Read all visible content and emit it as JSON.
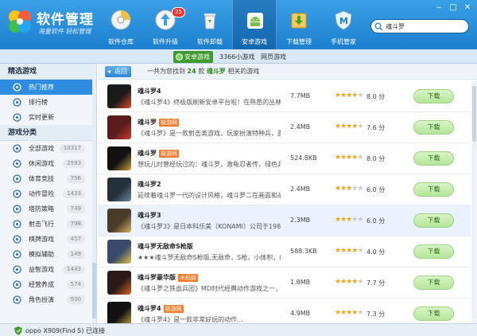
{
  "app": {
    "title": "软件管理",
    "subtitle": "海量软件 轻松管理",
    "window_controls": [
      "‒",
      "□",
      "✕"
    ]
  },
  "nav": [
    {
      "label": "软件仓库",
      "icon": "disc-icon"
    },
    {
      "label": "软件升级",
      "icon": "upgrade-icon",
      "badge": "25"
    },
    {
      "label": "软件卸载",
      "icon": "recycle-bin-icon"
    },
    {
      "label": "安卓游戏",
      "icon": "android-game-icon",
      "active": true
    },
    {
      "label": "下载管理",
      "icon": "download-icon"
    },
    {
      "label": "手机管家",
      "icon": "shield-icon"
    }
  ],
  "search": {
    "value": "魂斗罗"
  },
  "subtabs": [
    {
      "label": "安卓游戏",
      "active": true
    },
    {
      "label": "3366小游戏"
    },
    {
      "label": "网页游戏"
    }
  ],
  "sidebar": {
    "section1": "精选游戏",
    "featured": [
      {
        "label": "热门推荐",
        "icon": "thumbs-up-icon",
        "active": true
      },
      {
        "label": "排行榜",
        "icon": "trophy-icon"
      },
      {
        "label": "实时更新",
        "icon": "clock-icon"
      }
    ],
    "section2": "游戏分类",
    "categories": [
      {
        "label": "全部游戏",
        "count": "10317",
        "icon": "grid-icon"
      },
      {
        "label": "休闲游戏",
        "count": "2593",
        "icon": "coffee-icon"
      },
      {
        "label": "体育竞技",
        "count": "756",
        "icon": "ball-icon"
      },
      {
        "label": "动作冒险",
        "count": "1433",
        "icon": "run-icon"
      },
      {
        "label": "塔防策略",
        "count": "749",
        "icon": "tower-icon"
      },
      {
        "label": "射击飞行",
        "count": "798",
        "icon": "plane-icon"
      },
      {
        "label": "棋牌游戏",
        "count": "457",
        "icon": "card-icon"
      },
      {
        "label": "模拟辅助",
        "count": "149",
        "icon": "wrench-icon"
      },
      {
        "label": "益智游戏",
        "count": "1443",
        "icon": "puzzle-icon"
      },
      {
        "label": "经营养成",
        "count": "574",
        "icon": "coin-icon"
      },
      {
        "label": "角色扮演",
        "count": "500",
        "icon": "mask-icon"
      }
    ]
  },
  "results": {
    "back_label": "返回",
    "prefix": "一共为您找到",
    "count": "24",
    "unit": "款",
    "keyword": "魂斗罗",
    "suffix": "相关的游戏",
    "download_label": "下载"
  },
  "apps": [
    {
      "name": "魂斗罗4",
      "tag": "",
      "desc": "《魂斗罗4》终极版刷新安卓平台啦！在熟悉的丛林...",
      "size": "7.7MB",
      "stars": 4,
      "score": "8.0 分",
      "icon_color": "#1a1a1a",
      "accent": "#e0502a"
    },
    {
      "name": "魂斗罗",
      "tag": "极游网",
      "desc": "《魂斗罗》是一款射击类游戏，玩家扮演特种兵，面对大...",
      "size": "2.4MB",
      "stars": 4,
      "score": "7.6 分",
      "icon_color": "#5a1c1c",
      "accent": "#d03a2a"
    },
    {
      "name": "魂斗罗",
      "tag": "极游网",
      "desc": "想玩儿时曾经玩过的：魂斗罗，激龟忍者传，绿色兵...",
      "size": "524.8KB",
      "stars": 4,
      "score": "8.0 分",
      "icon_color": "#111111",
      "accent": "#c9a43a"
    },
    {
      "name": "魂斗罗2",
      "tag": "",
      "desc": "延续着魂斗罗一代的设计风格，魂斗罗二在画面和战...",
      "size": "2.4MB",
      "stars": 3,
      "score": "6.0 分",
      "icon_color": "#24303a",
      "accent": "#6a8aa0"
    },
    {
      "name": "魂斗罗3",
      "tag": "",
      "desc": "《魂斗罗3》是日本科乐美（KONAMI）公司于1988...",
      "size": "2.3MB",
      "stars": 3,
      "score": "6.0 分",
      "icon_color": "#4a3a2a",
      "accent": "#d8b060"
    },
    {
      "name": "魂斗罗无敌命S枪版",
      "tag": "",
      "desc": "★★★魂斗罗无敌命S枪版,无敌命，S枪，小体积，绝...",
      "size": "588.3KB",
      "stars": 4,
      "score": "4.0 分",
      "icon_color": "#3a4a6a",
      "accent": "#e0c040"
    },
    {
      "name": "魂斗罗豪华版",
      "tag": "木蚂蚁",
      "desc": "《魂斗罗之铁血兵团》MD时代经典动作游戏之一，游戏...",
      "size": "1.8MB",
      "stars": 4,
      "score": "7.7 分",
      "icon_color": "#2a1a1a",
      "accent": "#e06020"
    },
    {
      "name": "魂斗罗4",
      "tag": "极游网",
      "desc": "《魂斗罗4》是一款非常好玩的动作...",
      "size": "4.9MB",
      "stars": 4,
      "score": "7.3 分",
      "icon_color": "#111111",
      "accent": "#c9a43a"
    }
  ],
  "status": {
    "device": "oppo X909(Find 5)",
    "state": "已连接"
  }
}
